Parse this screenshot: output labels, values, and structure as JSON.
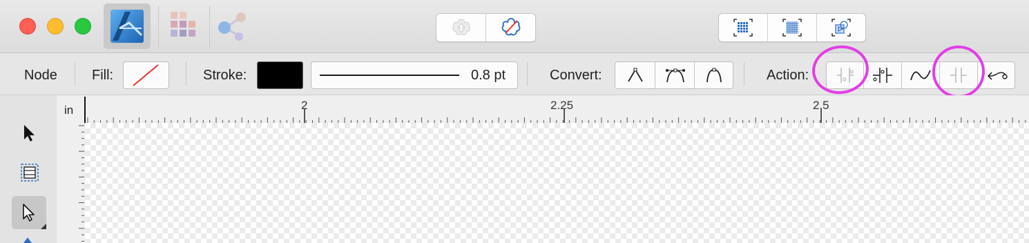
{
  "window": {
    "traffic_lights": {
      "close": "#fe5f57",
      "minimize": "#febc2e",
      "zoom": "#28c840"
    }
  },
  "context_toolbar": {
    "node_label": "Node",
    "fill_label": "Fill:",
    "stroke_label": "Stroke:",
    "stroke_width": "0.8 pt",
    "stroke_color": "#000000",
    "convert_label": "Convert:",
    "convert_buttons": [
      "sharp-convert-icon",
      "smooth-convert-icon",
      "smart-convert-icon"
    ],
    "action_label": "Action:",
    "action_buttons": [
      "break-curve-icon",
      "close-curve-icon",
      "smooth-curve-icon",
      "join-curves-icon",
      "reverse-curve-icon"
    ]
  },
  "ruler": {
    "unit": "in",
    "major_labels": [
      "2",
      "2.25",
      "2.5"
    ]
  },
  "tools": [
    "move-tool-icon",
    "artboard-tool-icon",
    "node-tool-icon"
  ],
  "annotations": {
    "highlight_color": "#e23ee6"
  }
}
